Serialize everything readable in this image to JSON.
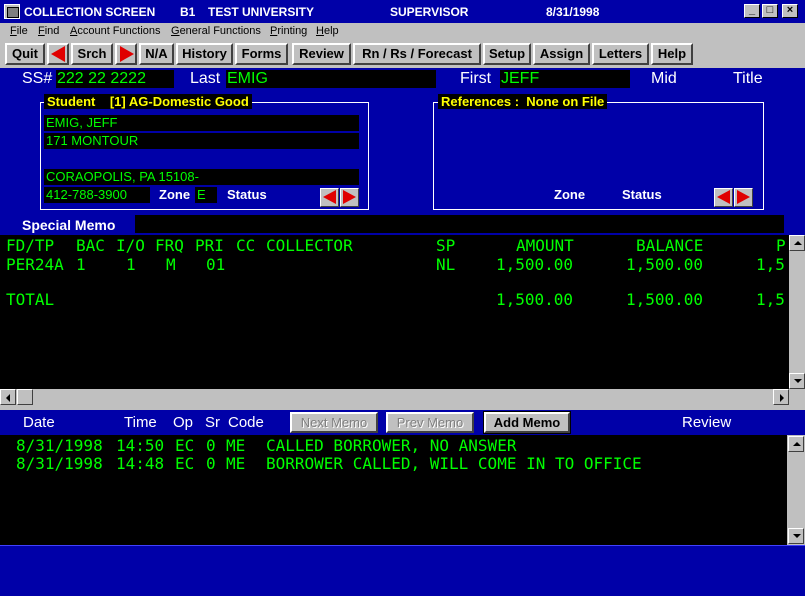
{
  "window": {
    "title_app": "COLLECTION SCREEN",
    "title_code": "B1",
    "title_org": "TEST UNIVERSITY",
    "title_role": "SUPERVISOR",
    "title_date": "8/31/1998",
    "minimize": "_",
    "maximize": "□",
    "close": "×"
  },
  "menu": [
    "File",
    "Find",
    "Account Functions",
    "General Functions",
    "Printing",
    "Help"
  ],
  "toolbar": {
    "quit": "Quit",
    "srch": "Srch",
    "na": "N/A",
    "history": "History",
    "forms": "Forms",
    "review": "Review",
    "rnrs": "Rn / Rs / Forecast",
    "setup": "Setup",
    "assign": "Assign",
    "letters": "Letters",
    "help": "Help"
  },
  "header": {
    "ss_label": "SS#",
    "ss_value": "222 22 2222",
    "last_label": "Last",
    "last_value": "EMIG",
    "first_label": "First",
    "first_value": "JEFF",
    "mid_label": "Mid",
    "mid_value": "",
    "title_label": "Title",
    "title_value": ""
  },
  "student": {
    "group_label": "Student",
    "group_status": "[1] AG-Domestic Good",
    "name": "EMIG, JEFF",
    "address1": "171 MONTOUR",
    "address2": "",
    "citystate": "CORAOPOLIS, PA 15108-",
    "phone": "412-788-3900",
    "zone_label": "Zone",
    "zone_value": "E",
    "status_label": "Status",
    "status_value": ""
  },
  "references": {
    "group_label": "References :",
    "group_status": "None on File",
    "zone_label": "Zone",
    "status_label": "Status"
  },
  "special_memo": {
    "label": "Special Memo",
    "value": ""
  },
  "grid": {
    "headers": [
      "FD/TP",
      "BAC",
      "I/O",
      "FRQ",
      "PRI",
      "CC",
      "COLLECTOR",
      "SP",
      "AMOUNT",
      "BALANCE",
      "P"
    ],
    "rows": [
      {
        "fdtp": "PER24A",
        "bac": "1",
        "io": "1",
        "frq": "M",
        "pri": "01",
        "cc": "",
        "collector": "",
        "sp": "NL",
        "amount": "1,500.00",
        "balance": "1,500.00",
        "p": "1,5"
      }
    ],
    "total": {
      "label": "TOTAL",
      "amount": "1,500.00",
      "balance": "1,500.00",
      "p": "1,5"
    }
  },
  "memo": {
    "hdr_date": "Date",
    "hdr_time": "Time",
    "hdr_op": "Op",
    "hdr_sr": "Sr",
    "hdr_code": "Code",
    "next_memo": "Next Memo",
    "prev_memo": "Prev Memo",
    "add_memo": "Add Memo",
    "review": "Review",
    "entries": [
      {
        "date": "8/31/1998",
        "time": "14:50",
        "op": "EC",
        "sr": "0",
        "code": "ME",
        "text": "CALLED BORROWER, NO ANSWER"
      },
      {
        "date": "8/31/1998",
        "time": "14:48",
        "op": "EC",
        "sr": "0",
        "code": "ME",
        "text": "BORROWER CALLED, WILL COME IN TO OFFICE"
      }
    ]
  },
  "colors": {
    "window_blue": "#0000a8",
    "field_bg": "#000000",
    "field_text": "#00ff00",
    "group_title": "#ffff00",
    "arrow_red": "#e00000"
  }
}
